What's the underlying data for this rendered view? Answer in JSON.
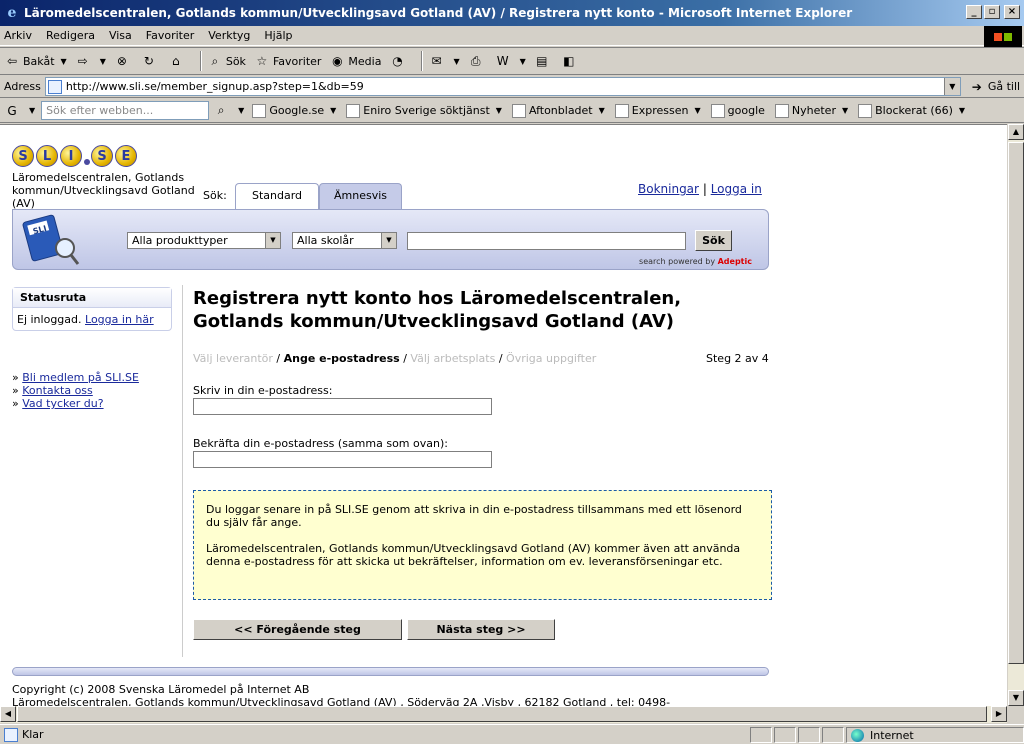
{
  "window": {
    "title": "Läromedelscentralen, Gotlands kommun/Utvecklingsavd Gotland (AV) / Registrera nytt konto - Microsoft Internet Explorer"
  },
  "menu": {
    "items": [
      "Arkiv",
      "Redigera",
      "Visa",
      "Favoriter",
      "Verktyg",
      "Hjälp"
    ]
  },
  "toolbar": {
    "back": "Bakåt",
    "search": "Sök",
    "favorites": "Favoriter",
    "media": "Media"
  },
  "address": {
    "label": "Adress",
    "url": "http://www.sli.se/member_signup.asp?step=1&db=59",
    "go": "Gå till"
  },
  "links": {
    "search_placeholder": "Sök efter webben...",
    "items": [
      "Google.se",
      "Eniro Sverige söktjänst",
      "Aftonbladet",
      "Expressen",
      "google",
      "Nyheter",
      "Blockerat (66)"
    ]
  },
  "page": {
    "logo_letters": [
      "S",
      "L",
      "I",
      "S",
      "E"
    ],
    "org_name": "Läromedelscentralen, Gotlands kommun/Utvecklingsavd Gotland (AV)",
    "search_label": "Sök:",
    "tabs": [
      "Standard",
      "Ämnesvis"
    ],
    "top_links": {
      "bookings": "Bokningar",
      "separator": "|",
      "login": "Logga in"
    },
    "product_select": "Alla produkttyper",
    "grade_select": "Alla skolår",
    "search_button": "Sök",
    "powered_by": "search powered by",
    "powered_brand": "Adeptic",
    "statusbox": {
      "title": "Statusruta",
      "text": "Ej inloggad.",
      "link": "Logga in här"
    },
    "left_links": [
      "Bli medlem på SLI.SE",
      "Kontakta oss",
      "Vad tycker du?"
    ],
    "title": "Registrera nytt konto hos Läromedelscentralen, Gotlands kommun/Utvecklingsavd Gotland (AV)",
    "steps": {
      "s1": "Välj leverantör",
      "s2": "Ange e-postadress",
      "s3": "Välj arbetsplats",
      "s4": "Övriga uppgifter",
      "sep": "/",
      "count": "Steg 2 av 4"
    },
    "email_label": "Skriv in din e-postadress:",
    "email_confirm_label": "Bekräfta din e-postadress (samma som ovan):",
    "info_p1": "Du loggar senare in på SLI.SE genom att skriva in din e-postadress tillsammans med ett lösenord du själv får ange.",
    "info_p2": "Läromedelscentralen, Gotlands kommun/Utvecklingsavd Gotland (AV) kommer även att använda denna e-postadress för att skicka ut bekräftelser, information om ev. leveransförseningar etc.",
    "prev_button": "<< Föregående steg",
    "next_button": "Nästa steg >>",
    "footer_line1": "Copyright (c) 2008 Svenska Läromedel på Internet AB",
    "footer_line2": "Läromedelscentralen, Gotlands kommun/Utvecklingsavd Gotland (AV) , Söderväg 2A ,Visby , 62182  Gotland , tel: 0498-"
  },
  "status": {
    "text": "Klar",
    "zone": "Internet"
  }
}
